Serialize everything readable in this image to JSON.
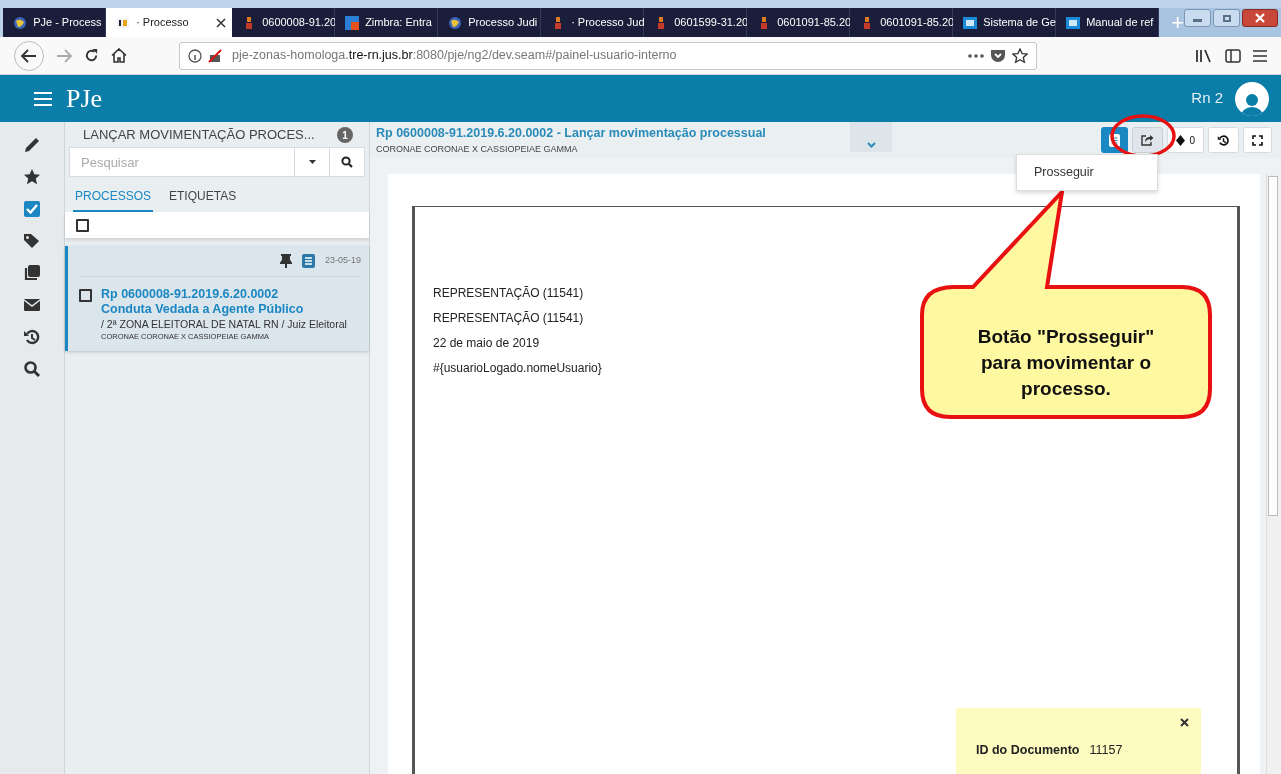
{
  "browser": {
    "tabs": [
      {
        "title": "PJe - Process",
        "kind": "globe",
        "selected": false
      },
      {
        "title": "· Processo",
        "kind": "pje",
        "selected": true
      },
      {
        "title": "0600008-91.20",
        "kind": "court",
        "selected": false
      },
      {
        "title": "Zimbra: Entra",
        "kind": "mail",
        "selected": false
      },
      {
        "title": "Processo Judi",
        "kind": "globe",
        "selected": false
      },
      {
        "title": "· Processo Jud",
        "kind": "court",
        "selected": false
      },
      {
        "title": "0601599-31.20",
        "kind": "court",
        "selected": false
      },
      {
        "title": "0601091-85.20",
        "kind": "court",
        "selected": false
      },
      {
        "title": "0601091-85.20",
        "kind": "court",
        "selected": false
      },
      {
        "title": "Sistema de Ge",
        "kind": "cnj",
        "selected": false
      },
      {
        "title": "Manual de ref",
        "kind": "cnj",
        "selected": false
      }
    ],
    "new_tab": "+",
    "url": {
      "prefix": "pje-zonas-homologa.",
      "domain": "tre-rn.jus.br",
      "suffix": ":8080/pje/ng2/dev.seam#/painel-usuario-interno"
    }
  },
  "app": {
    "logo": "PJe",
    "user": "Rn 2"
  },
  "sidebar": [
    {
      "kind": "pencil",
      "selected": false
    },
    {
      "kind": "star",
      "selected": false
    },
    {
      "kind": "check",
      "selected": true
    },
    {
      "kind": "tags",
      "selected": false
    },
    {
      "kind": "copy",
      "selected": false
    },
    {
      "kind": "mail",
      "selected": false
    },
    {
      "kind": "history",
      "selected": false
    },
    {
      "kind": "search",
      "selected": false
    }
  ],
  "task_panel": {
    "title": "LANÇAR MOVIMENTAÇÃO PROCES...",
    "count": "1",
    "search": {
      "placeholder": "Pesquisar"
    },
    "tabs": [
      {
        "label": "PROCESSOS",
        "selected": true
      },
      {
        "label": "ETIQUETAS",
        "selected": false
      }
    ],
    "select_all": {
      "checked": false
    },
    "processes": [
      {
        "date": "23-05-19",
        "number": "Rp 0600008-91.2019.6.20.0002",
        "subject": "Conduta Vedada a Agente Público",
        "location": "/ 2ª ZONA ELEITORAL DE NATAL RN / Juiz Eleitoral",
        "parties": "CORONAE CORONAE X CASSIOPEIAE GAMMA",
        "checked": false,
        "selected": true
      }
    ]
  },
  "detail": {
    "title": "Rp 0600008-91.2019.6.20.0002 - Lançar movimentação processual",
    "parties": "CORONAE CORONAE X CASSIOPEIAE GAMMA",
    "toolbar": [
      {
        "kind": "document",
        "selected": true
      },
      {
        "kind": "forward",
        "selected": false
      },
      {
        "kind": "tag",
        "count": "0"
      },
      {
        "kind": "history"
      },
      {
        "kind": "fullscreen"
      }
    ],
    "menu": [
      "Prosseguir"
    ],
    "document": {
      "lines": [
        "REPRESENTAÇÃO (11541)",
        "REPRESENTAÇÃO (11541)",
        "22 de maio de 2019",
        "#{usuarioLogado.nomeUsuario}"
      ]
    },
    "info_box": {
      "label": "ID do Documento",
      "value": "11157"
    }
  },
  "callout": {
    "text": "Botão \"Prosseguir\" para movimentar o processo."
  }
}
